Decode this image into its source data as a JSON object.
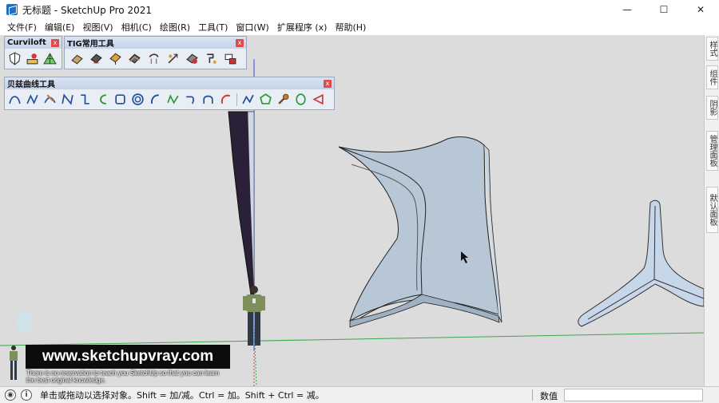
{
  "window": {
    "title": "无标题 - SketchUp Pro 2021",
    "minimize_glyph": "—",
    "maximize_glyph": "☐",
    "close_glyph": "✕"
  },
  "menu": {
    "items": [
      "文件(F)",
      "编辑(E)",
      "视图(V)",
      "相机(C)",
      "绘图(R)",
      "工具(T)",
      "窗口(W)",
      "扩展程序 (x)",
      "帮助(H)"
    ]
  },
  "toolbars": {
    "curviloft": {
      "title": "Curviloft",
      "close": "x",
      "icons": [
        "loft-shield-icon",
        "loft-skin-icon",
        "loft-triangle-icon"
      ]
    },
    "tig": {
      "title": "TIG常用工具",
      "close": "x",
      "icons": [
        "tig-tool-1-icon",
        "tig-tool-2-icon",
        "tig-tool-3-icon",
        "tig-tool-4-icon",
        "tig-tool-5-icon",
        "tig-tool-6-icon",
        "tig-tool-7-icon",
        "tig-tool-8-icon",
        "tig-tool-9-icon"
      ]
    },
    "bezier": {
      "title": "贝兹曲线工具",
      "close": "x",
      "icons": [
        "arc-curve-icon",
        "zigzag-curve-icon",
        "brush-curve-icon",
        "n-curve-icon",
        "s-curve-icon",
        "open-arc-icon",
        "square-curve-icon",
        "spiral-curve-icon",
        "c-arc-icon",
        "wave-curve-icon",
        "hook-curve-icon",
        "arch-curve-icon",
        "red-arc-icon",
        "line-curve-icon",
        "polygon-curve-icon",
        "wrench-icon",
        "circle-curve-icon",
        "fan-curve-icon"
      ]
    }
  },
  "tray": {
    "tabs": [
      "样式",
      "组件",
      "阴影",
      "管理面板",
      "默认面板"
    ]
  },
  "watermark": {
    "url": "www.sketchupvray.com",
    "line1": "There is no reservation to teach you SketchUp so that you can learn",
    "line2": "the best original knowledge."
  },
  "status": {
    "hint": "单击或拖动以选择对象。Shift = 加/减。Ctrl = 加。Shift + Ctrl = 减。",
    "measurements_label": "数值",
    "measurements_value": ""
  },
  "colors": {
    "viewport_bg": "#dcdcdc",
    "surface_fill": "#b7c7d6",
    "accent_red_axis": "#c84a3a",
    "green_axis": "#3aa64a",
    "toolbar_bg": "#e9eef5"
  }
}
